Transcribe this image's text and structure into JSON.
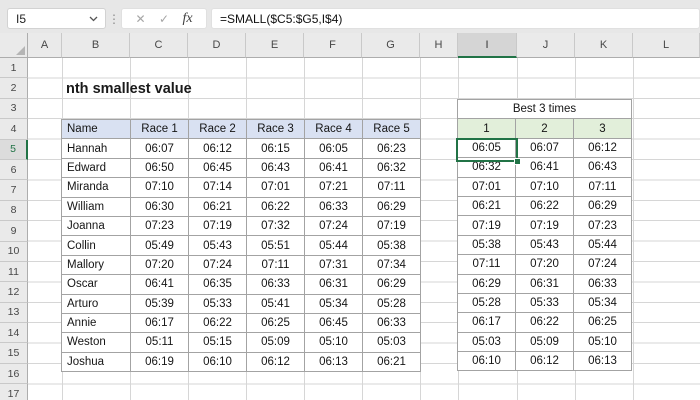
{
  "formula_bar": {
    "cell_reference": "I5",
    "formula": "=SMALL($C5:$G5,I$4)",
    "icons": {
      "splitter_glyph": "⋮",
      "cancel_glyph": "✕",
      "enter_glyph": "✓",
      "function_glyph": "fx"
    }
  },
  "sheet": {
    "title": "nth smallest value",
    "selected_cell": "I5",
    "selected_column": "I",
    "selected_row": "5",
    "accent_color": "#217346",
    "column_headers": [
      "A",
      "B",
      "C",
      "D",
      "E",
      "F",
      "G",
      "H",
      "I",
      "J",
      "K",
      "L"
    ],
    "row_headers": [
      "1",
      "2",
      "3",
      "4",
      "5",
      "6",
      "7",
      "8",
      "9",
      "10",
      "11",
      "12",
      "13",
      "14",
      "15",
      "16",
      "17"
    ]
  },
  "race_table": {
    "header_fill": "#D9E1F2",
    "headers": [
      "Name",
      "Race 1",
      "Race 2",
      "Race 3",
      "Race 4",
      "Race 5"
    ],
    "rows": [
      [
        "Hannah",
        "06:07",
        "06:12",
        "06:15",
        "06:05",
        "06:23"
      ],
      [
        "Edward",
        "06:50",
        "06:45",
        "06:43",
        "06:41",
        "06:32"
      ],
      [
        "Miranda",
        "07:10",
        "07:14",
        "07:01",
        "07:21",
        "07:11"
      ],
      [
        "William",
        "06:30",
        "06:21",
        "06:22",
        "06:33",
        "06:29"
      ],
      [
        "Joanna",
        "07:23",
        "07:19",
        "07:32",
        "07:24",
        "07:19"
      ],
      [
        "Collin",
        "05:49",
        "05:43",
        "05:51",
        "05:44",
        "05:38"
      ],
      [
        "Mallory",
        "07:20",
        "07:24",
        "07:11",
        "07:31",
        "07:34"
      ],
      [
        "Oscar",
        "06:41",
        "06:35",
        "06:33",
        "06:31",
        "06:29"
      ],
      [
        "Arturo",
        "05:39",
        "05:33",
        "05:41",
        "05:34",
        "05:28"
      ],
      [
        "Annie",
        "06:17",
        "06:22",
        "06:25",
        "06:45",
        "06:33"
      ],
      [
        "Weston",
        "05:11",
        "05:15",
        "05:09",
        "05:10",
        "05:03"
      ],
      [
        "Joshua",
        "06:19",
        "06:10",
        "06:12",
        "06:13",
        "06:21"
      ]
    ]
  },
  "best_table": {
    "title": "Best 3 times",
    "header_fill": "#E2EFDA",
    "headers": [
      "1",
      "2",
      "3"
    ],
    "rows": [
      [
        "06:05",
        "06:07",
        "06:12"
      ],
      [
        "06:32",
        "06:41",
        "06:43"
      ],
      [
        "07:01",
        "07:10",
        "07:11"
      ],
      [
        "06:21",
        "06:22",
        "06:29"
      ],
      [
        "07:19",
        "07:19",
        "07:23"
      ],
      [
        "05:38",
        "05:43",
        "05:44"
      ],
      [
        "07:11",
        "07:20",
        "07:24"
      ],
      [
        "06:29",
        "06:31",
        "06:33"
      ],
      [
        "05:28",
        "05:33",
        "05:34"
      ],
      [
        "06:17",
        "06:22",
        "06:25"
      ],
      [
        "05:03",
        "05:09",
        "05:10"
      ],
      [
        "06:10",
        "06:12",
        "06:13"
      ]
    ]
  }
}
